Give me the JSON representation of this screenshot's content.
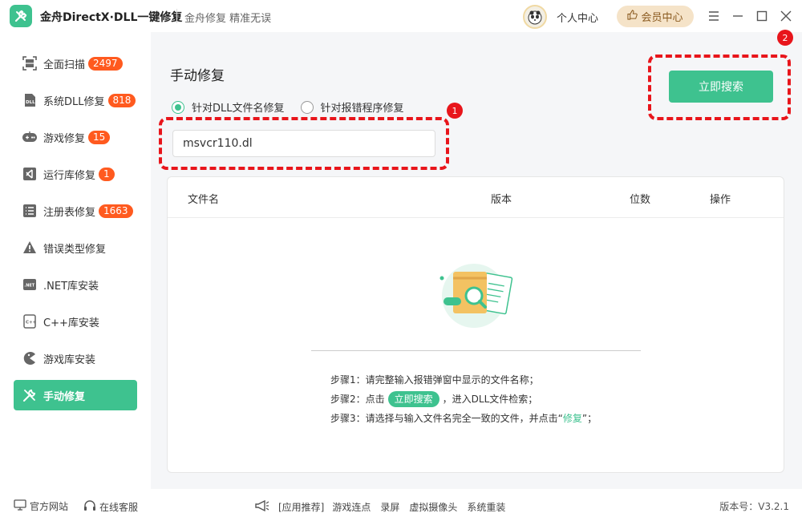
{
  "app": {
    "title": "金舟DirectX·DLL一键修复",
    "subtitle": "金舟修复 精准无误",
    "user_center": "个人中心",
    "vip_center": "会员中心"
  },
  "sidebar": {
    "items": [
      {
        "label": "全面扫描",
        "badge": "2497",
        "icon": "scan-icon"
      },
      {
        "label": "系统DLL修复",
        "badge": "818",
        "icon": "dll-icon"
      },
      {
        "label": "游戏修复",
        "badge": "15",
        "icon": "gamepad-icon"
      },
      {
        "label": "运行库修复",
        "badge": "1",
        "icon": "vs-runtime-icon"
      },
      {
        "label": "注册表修复",
        "badge": "1663",
        "icon": "registry-icon"
      },
      {
        "label": "错误类型修复",
        "badge": "",
        "icon": "warning-icon"
      },
      {
        "label": ".NET库安装",
        "badge": "",
        "icon": "dotnet-icon"
      },
      {
        "label": "C++库安装",
        "badge": "",
        "icon": "cpp-icon"
      },
      {
        "label": "游戏库安装",
        "badge": "",
        "icon": "pacman-icon"
      },
      {
        "label": "手动修复",
        "badge": "",
        "icon": "tools-icon"
      }
    ]
  },
  "main": {
    "title": "手动修复",
    "radio_dll": "针对DLL文件名修复",
    "radio_program": "针对报错程序修复",
    "input_value": "msvcr110.dl",
    "search_button": "立即搜索",
    "marker_1": "1",
    "marker_2": "2",
    "table": {
      "headers": [
        "文件名",
        "版本",
        "位数",
        "操作"
      ]
    },
    "steps": {
      "step1": "步骤1：请完整输入报错弹窗中显示的文件名称；",
      "step2_prefix": "步骤2：点击",
      "step2_button": "立即搜索",
      "step2_suffix": "，进入DLL文件检索；",
      "step3_prefix": "步骤3：请选择与输入文件名完全一致的文件，并点击“",
      "step3_word": "修复",
      "step3_suffix": "”；"
    }
  },
  "footer": {
    "official_site": "官方网站",
    "online_service": "在线客服",
    "recommend": "[应用推荐]",
    "links": [
      "游戏连点",
      "录屏",
      "虚拟摄像头",
      "系统重装"
    ],
    "version": "版本号：V3.2.1"
  },
  "colors": {
    "accent": "#3ec28f",
    "badge": "#ff5a1f",
    "highlight": "#e8151b",
    "vip_bg": "#f5e3c8"
  }
}
